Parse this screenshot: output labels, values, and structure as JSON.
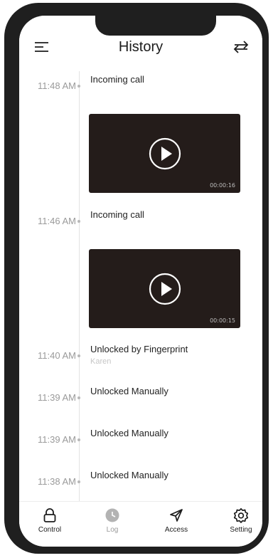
{
  "header": {
    "title": "History"
  },
  "entries": [
    {
      "time": "11:48 AM",
      "label": "Incoming call"
    },
    {
      "time": "11:46 AM",
      "label": "Incoming call"
    },
    {
      "time": "11:40 AM",
      "label": "Unlocked by Fingerprint",
      "sub": "Karen"
    },
    {
      "time": "11:39 AM",
      "label": "Unlocked Manually"
    },
    {
      "time": "11:39 AM",
      "label": "Unlocked Manually"
    },
    {
      "time": "11:38 AM",
      "label": "Unlocked Manually"
    }
  ],
  "videos": [
    {
      "duration": "00:00:16"
    },
    {
      "duration": "00:00:15"
    }
  ],
  "nav": [
    {
      "label": "Control",
      "icon": "lock-icon"
    },
    {
      "label": "Log",
      "icon": "clock-icon",
      "active": false
    },
    {
      "label": "Access",
      "icon": "send-icon"
    },
    {
      "label": "Setting",
      "icon": "gear-icon"
    }
  ]
}
